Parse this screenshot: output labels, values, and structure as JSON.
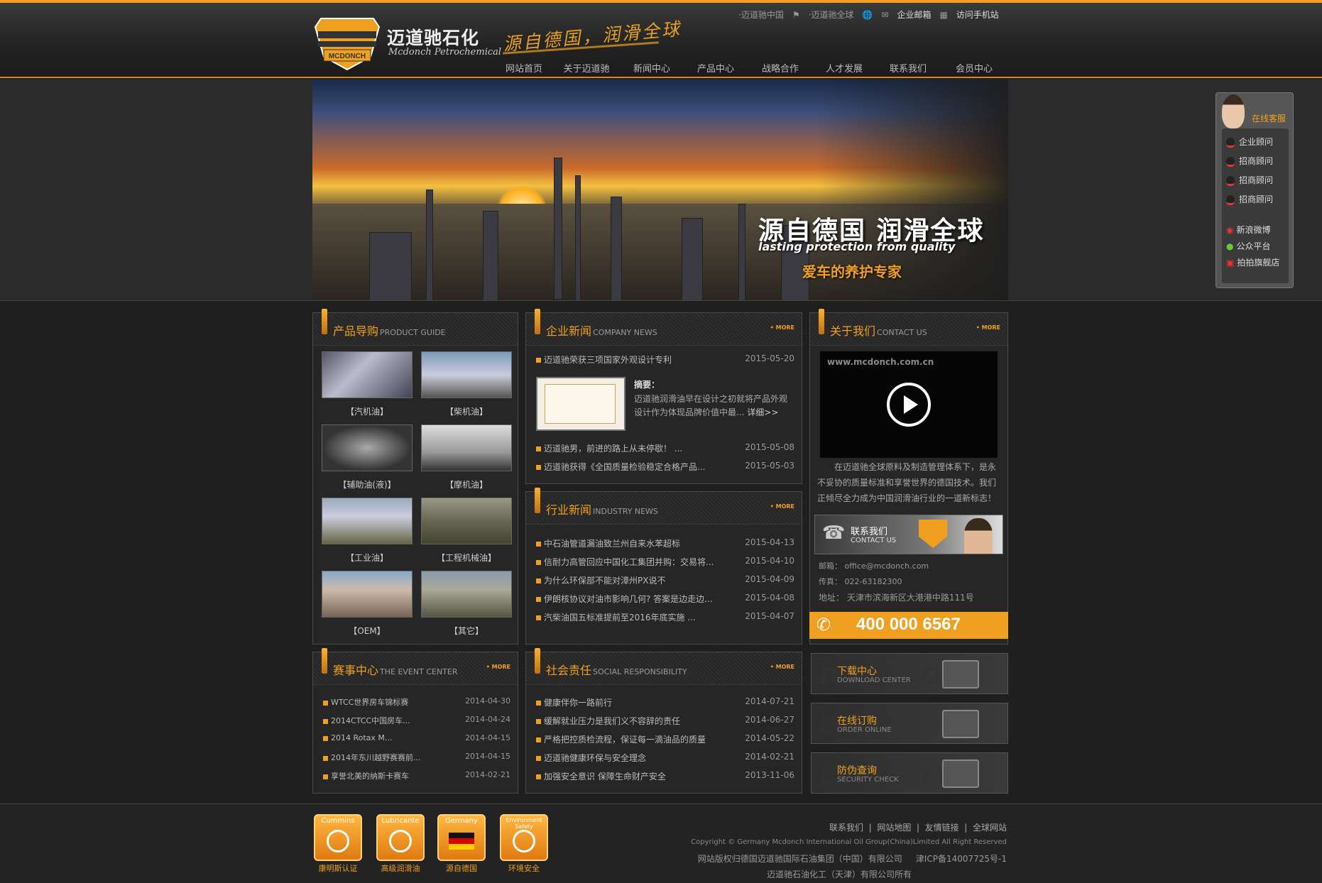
{
  "brand": {
    "name_cn": "迈道驰石化",
    "name_en": "Mcdonch Petrochemical",
    "shield_text": "MCDONCH",
    "slogan": "源自德国，润滑全球"
  },
  "toplinks": [
    "·迈道驰中国",
    "·迈道驰全球",
    "企业邮箱",
    "访问手机站"
  ],
  "nav": [
    "网站首页",
    "关于迈道驰",
    "新闻中心",
    "产品中心",
    "战略合作",
    "人才发展",
    "联系我们",
    "会员中心"
  ],
  "banner": {
    "title": "源自德国 润滑全球",
    "subtitle": "lasting protection from quality",
    "tagline": "爱车的养护专家"
  },
  "service": {
    "title": "在线客服",
    "items": [
      "企业顾问",
      "招商顾问",
      "招商顾问",
      "招商顾问"
    ],
    "social": [
      "新浪微博",
      "公众平台",
      "拍拍旗舰店"
    ]
  },
  "products": {
    "title": "产品导购",
    "title_en": "PRODUCT GUIDE",
    "items": [
      "【汽机油】",
      "【柴机油】",
      "【辅助油(液)】",
      "【摩机油】",
      "【工业油】",
      "【工程机械油】",
      "【OEM】",
      "【其它】"
    ]
  },
  "company_news": {
    "title": "企业新闻",
    "title_en": "COMPANY NEWS",
    "more": "• MORE",
    "top": {
      "title": "迈道驰荣获三项国家外观设计专利",
      "date": "2015-05-20"
    },
    "summary_label": "摘要：",
    "summary": "迈道驰润滑油早在设计之初就将产品外观设计作为体现品牌价值中最...",
    "detail": "详细>>",
    "items": [
      {
        "title": "迈道驰男，前进的路上从未停歇！ ...",
        "date": "2015-05-08"
      },
      {
        "title": "迈道驰获得《全国质量检验稳定合格产品...",
        "date": "2015-05-03"
      }
    ]
  },
  "industry_news": {
    "title": "行业新闻",
    "title_en": "INDUSTRY NEWS",
    "more": "• MORE",
    "items": [
      {
        "title": "中石油管道漏油致兰州自来水苯超标",
        "date": "2015-04-13"
      },
      {
        "title": "信耐力高管回应中国化工集团并购：交易将...",
        "date": "2015-04-10"
      },
      {
        "title": "为什么环保部不能对漳州PX说不",
        "date": "2015-04-09"
      },
      {
        "title": "伊朗核协议对油市影响几何? 答案是边走边...",
        "date": "2015-04-08"
      },
      {
        "title": "汽柴油国五标准提前至2016年底实施 ...",
        "date": "2015-04-07"
      }
    ]
  },
  "about": {
    "title": "关于我们",
    "title_en": "CONTACT US",
    "more": "• MORE",
    "video_url_text": "www.mcdonch.com.cn",
    "text": [
      "在迈道驰全球原料及制造管理体系下，是永",
      "不妥协的质量标准和享誉世界的德国技术。我们",
      "正倾尽全力成为中国润滑油行业的一道新标志！"
    ],
    "contact_cn": "联系我们",
    "contact_en": "CONTACT US",
    "email": "邮箱： office@mcdonch.com",
    "fax": "传真： 022-63182300",
    "address": "地址： 天津市滨海新区大港港中路111号",
    "hotline": "400 000 6567"
  },
  "events": {
    "title": "赛事中心",
    "title_en": "THE EVENT CENTER",
    "more": "• MORE",
    "items": [
      {
        "title": "WTCC世界房车锦标赛",
        "date": "2014-04-30"
      },
      {
        "title": "2014CTCC中国房车...",
        "date": "2014-04-24"
      },
      {
        "title": "2014 Rotax M...",
        "date": "2014-04-15"
      },
      {
        "title": "2014年东川越野赛赛前...",
        "date": "2014-04-15"
      },
      {
        "title": "享誉北美的纳斯卡赛车",
        "date": "2014-02-21"
      }
    ]
  },
  "social": {
    "title": "社会责任",
    "title_en": "SOCIAL RESPONSIBILITY",
    "more": "• MORE",
    "items": [
      {
        "title": "健康伴你一路前行",
        "date": "2014-07-21"
      },
      {
        "title": "缓解就业压力是我们义不容辞的责任",
        "date": "2014-06-27"
      },
      {
        "title": "严格把控质检流程，保证每一滴油品的质量",
        "date": "2014-05-22"
      },
      {
        "title": "迈道驰健康环保与安全理念",
        "date": "2014-02-21"
      },
      {
        "title": "加强安全意识 保障生命财产安全",
        "date": "2013-11-06"
      }
    ]
  },
  "side_buttons": [
    {
      "cn": "下载中心",
      "en": "DOWNLOAD CENTER",
      "bg": "DOWNLOAD"
    },
    {
      "cn": "在线订购",
      "en": "ORDER ONLINE",
      "bg": "ORDER"
    },
    {
      "cn": "防伪查询",
      "en": "SECURITY CHECK",
      "bg": "SECURITY"
    }
  ],
  "footer": {
    "badges": [
      {
        "top": "Cummins",
        "caption": "康明斯认证"
      },
      {
        "top": "Lubricante",
        "caption": "高级润滑油"
      },
      {
        "top": "Germany",
        "caption": "源自德国"
      },
      {
        "top": "Environment Safety",
        "caption": "环境安全"
      }
    ],
    "links": [
      "联系我们",
      "网站地图",
      "友情链接",
      "全球网站"
    ],
    "copyright": "Copyright © Germany Mcdonch International Oil Group(China)Limited All Right Reserved",
    "rights": "网站版权归德国迈道驰国际石油集团（中国）有限公司",
    "icp": "津ICP备14007725号-1",
    "company": "迈道驰石油化工（天津）有限公司所有"
  }
}
